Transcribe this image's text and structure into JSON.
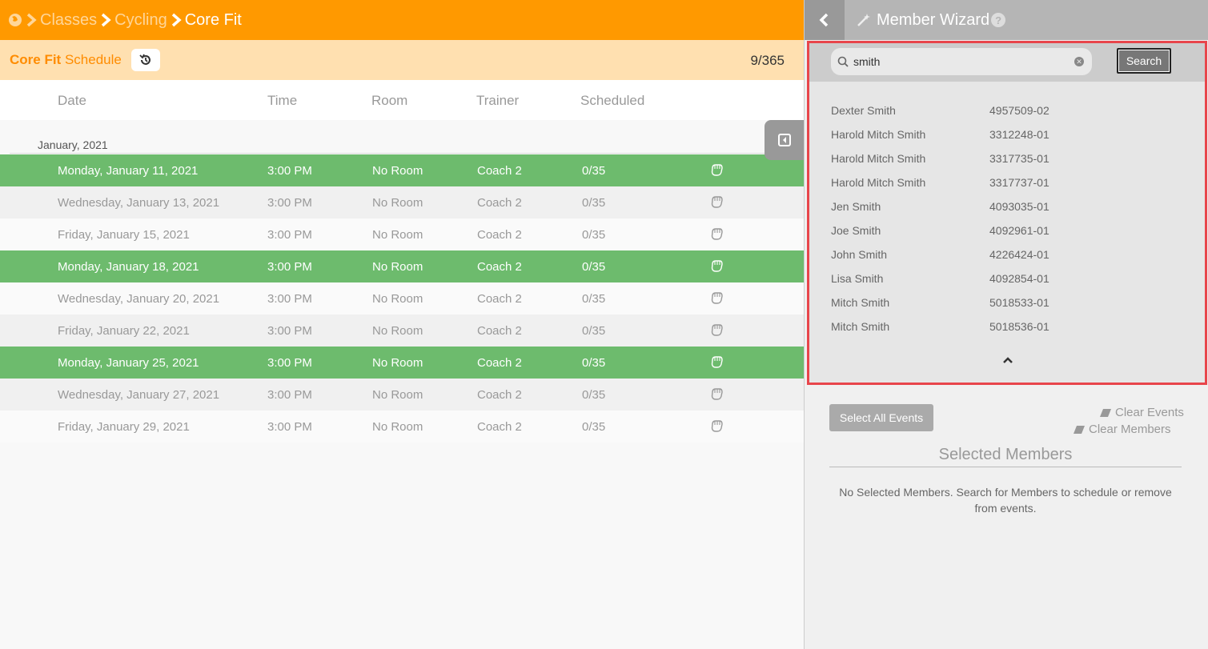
{
  "breadcrumb": {
    "items": [
      "Classes",
      "Cycling",
      "Core Fit"
    ]
  },
  "schedule": {
    "title_bold": "Core Fit",
    "title_rest": "Schedule",
    "counter": "9/365"
  },
  "table": {
    "headers": [
      "Date",
      "Time",
      "Room",
      "Trainer",
      "Scheduled"
    ],
    "month_label": "January, 2021",
    "rows": [
      {
        "date": "Monday, January 11, 2021",
        "time": "3:00 PM",
        "room": "No Room",
        "trainer": "Coach 2",
        "scheduled": "0/35",
        "selected": true
      },
      {
        "date": "Wednesday, January 13, 2021",
        "time": "3:00 PM",
        "room": "No Room",
        "trainer": "Coach 2",
        "scheduled": "0/35",
        "selected": false
      },
      {
        "date": "Friday, January 15, 2021",
        "time": "3:00 PM",
        "room": "No Room",
        "trainer": "Coach 2",
        "scheduled": "0/35",
        "selected": false
      },
      {
        "date": "Monday, January 18, 2021",
        "time": "3:00 PM",
        "room": "No Room",
        "trainer": "Coach 2",
        "scheduled": "0/35",
        "selected": true
      },
      {
        "date": "Wednesday, January 20, 2021",
        "time": "3:00 PM",
        "room": "No Room",
        "trainer": "Coach 2",
        "scheduled": "0/35",
        "selected": false
      },
      {
        "date": "Friday, January 22, 2021",
        "time": "3:00 PM",
        "room": "No Room",
        "trainer": "Coach 2",
        "scheduled": "0/35",
        "selected": false
      },
      {
        "date": "Monday, January 25, 2021",
        "time": "3:00 PM",
        "room": "No Room",
        "trainer": "Coach 2",
        "scheduled": "0/35",
        "selected": true
      },
      {
        "date": "Wednesday, January 27, 2021",
        "time": "3:00 PM",
        "room": "No Room",
        "trainer": "Coach 2",
        "scheduled": "0/35",
        "selected": false
      },
      {
        "date": "Friday, January 29, 2021",
        "time": "3:00 PM",
        "room": "No Room",
        "trainer": "Coach 2",
        "scheduled": "0/35",
        "selected": false
      }
    ]
  },
  "wizard": {
    "title": "Member Wizard",
    "help_label": "?",
    "search": {
      "value": "smith",
      "button_label": "Search"
    },
    "results": [
      {
        "name": "Dexter Smith",
        "id": "4957509-02"
      },
      {
        "name": "Harold Mitch Smith",
        "id": "3312248-01"
      },
      {
        "name": "Harold Mitch Smith",
        "id": "3317735-01"
      },
      {
        "name": "Harold Mitch Smith",
        "id": "3317737-01"
      },
      {
        "name": "Jen Smith",
        "id": "4093035-01"
      },
      {
        "name": "Joe Smith",
        "id": "4092961-01"
      },
      {
        "name": "John Smith",
        "id": "4226424-01"
      },
      {
        "name": "Lisa Smith",
        "id": "4092854-01"
      },
      {
        "name": "Mitch Smith",
        "id": "5018533-01"
      },
      {
        "name": "Mitch Smith",
        "id": "5018536-01"
      }
    ],
    "select_all_label": "Select All Events",
    "clear_events_label": "Clear Events",
    "clear_members_label": "Clear Members",
    "selected_members_title": "Selected Members",
    "empty_message": "No Selected Members. Search for Members to schedule or remove from events."
  },
  "colors": {
    "brand_orange": "#ff9900",
    "selected_green": "#6dbb6d",
    "highlight_red": "#e8454b"
  }
}
